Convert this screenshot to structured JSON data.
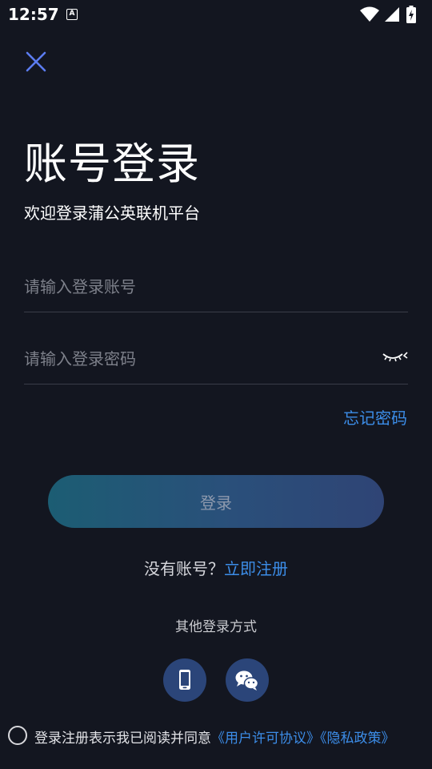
{
  "status_bar": {
    "time": "12:57",
    "notification_icon_letter": "A"
  },
  "header": {
    "title": "账号登录",
    "subtitle": "欢迎登录蒲公英联机平台"
  },
  "form": {
    "account_placeholder": "请输入登录账号",
    "password_placeholder": "请输入登录密码",
    "forgot_password": "忘记密码",
    "login_button": "登录"
  },
  "register": {
    "question": "没有账号？",
    "link": "立即注册"
  },
  "other_login": {
    "label": "其他登录方式",
    "methods": [
      "phone-icon",
      "wechat-icon"
    ]
  },
  "agreement": {
    "text": "登录注册表示我已阅读并同意",
    "user_license": "《用户许可协议》",
    "privacy_policy": "《隐私政策》"
  },
  "colors": {
    "background": "#131620",
    "accent": "#3c8de8",
    "button_gradient_start": "#1c5d73",
    "button_gradient_end": "#2f4475",
    "circle_button": "#2b4579"
  }
}
